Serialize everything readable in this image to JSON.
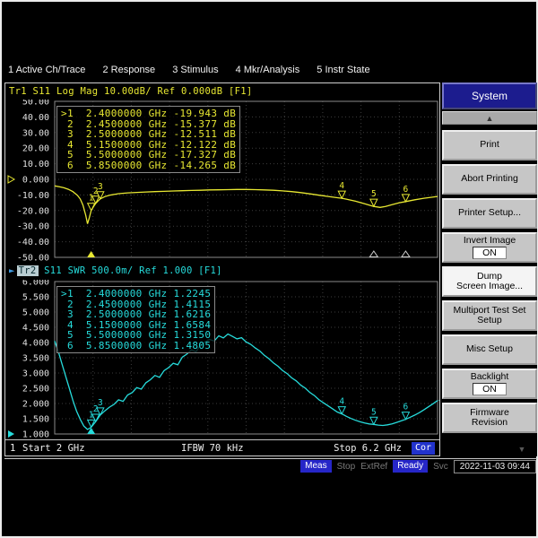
{
  "menu_bar": {
    "items": [
      "1 Active Ch/Trace",
      "2 Response",
      "3 Stimulus",
      "4 Mkr/Analysis",
      "5 Instr State"
    ]
  },
  "trace1": {
    "label": "Tr1",
    "params": "S11 Log Mag 10.00dB/ Ref 0.000dB [F1]",
    "markers": [
      {
        "sel": ">",
        "n": "1",
        "freq": "2.4000000 GHz",
        "val": "-19.943 dB"
      },
      {
        "sel": " ",
        "n": "2",
        "freq": "2.4500000 GHz",
        "val": "-15.377 dB"
      },
      {
        "sel": " ",
        "n": "3",
        "freq": "2.5000000 GHz",
        "val": "-12.511 dB"
      },
      {
        "sel": " ",
        "n": "4",
        "freq": "5.1500000 GHz",
        "val": "-12.122 dB"
      },
      {
        "sel": " ",
        "n": "5",
        "freq": "5.5000000 GHz",
        "val": "-17.327 dB"
      },
      {
        "sel": " ",
        "n": "6",
        "freq": "5.8500000 GHz",
        "val": "-14.265 dB"
      }
    ]
  },
  "trace2": {
    "pointer": "►",
    "label": "Tr2",
    "params": "S11 SWR 500.0m/ Ref 1.000 [F1]",
    "markers": [
      {
        "sel": ">",
        "n": "1",
        "freq": "2.4000000 GHz",
        "val": "1.2245"
      },
      {
        "sel": " ",
        "n": "2",
        "freq": "2.4500000 GHz",
        "val": "1.4115"
      },
      {
        "sel": " ",
        "n": "3",
        "freq": "2.5000000 GHz",
        "val": "1.6216"
      },
      {
        "sel": " ",
        "n": "4",
        "freq": "5.1500000 GHz",
        "val": "1.6584"
      },
      {
        "sel": " ",
        "n": "5",
        "freq": "5.5000000 GHz",
        "val": "1.3150"
      },
      {
        "sel": " ",
        "n": "6",
        "freq": "5.8500000 GHz",
        "val": "1.4805"
      }
    ]
  },
  "status_bar": {
    "channel": "1",
    "start": "Start 2 GHz",
    "ifbw": "IFBW 70 kHz",
    "stop": "Stop 6.2 GHz",
    "cor": "Cor"
  },
  "bottom_bar": {
    "meas": "Meas",
    "stop": "Stop",
    "extref": "ExtRef",
    "ready": "Ready",
    "svc": "Svc",
    "datetime": "2022-11-03 09:44"
  },
  "softkeys": {
    "title": "System",
    "up_icon": "▲",
    "down_icon": "▼",
    "buttons": [
      {
        "lines": [
          "Print"
        ]
      },
      {
        "lines": [
          "Abort Printing"
        ]
      },
      {
        "lines": [
          "Printer Setup..."
        ]
      },
      {
        "lines": [
          "Invert Image"
        ],
        "state": "ON"
      },
      {
        "lines": [
          "Dump",
          "Screen Image..."
        ],
        "selected": true
      },
      {
        "lines": [
          "Multiport Test Set",
          "Setup"
        ]
      },
      {
        "lines": [
          "Misc Setup"
        ]
      },
      {
        "lines": [
          "Backlight"
        ],
        "state": "ON"
      },
      {
        "lines": [
          "Firmware",
          "Revision"
        ]
      }
    ]
  },
  "colors": {
    "trace1": "#e8e832",
    "trace2": "#26dcdc",
    "grid": "#3d3d3d",
    "badge_blue": "#2626c8"
  },
  "chart_data": [
    {
      "type": "line",
      "title": "Tr1 S11 Log Mag 10.00dB/ Ref 0.000dB [F1]",
      "x_unit": "GHz",
      "y_unit": "dB",
      "x_range": [
        2.0,
        6.2
      ],
      "y_range": [
        -50,
        50
      ],
      "scale_per_div": "10.00dB/",
      "ref_level": "0.000dB",
      "color": "#e8e832",
      "y_tick_labels": [
        "50.00",
        "40.00",
        "30.00",
        "20.00",
        "10.00",
        "0.000",
        "-10.00",
        "-20.00",
        "-30.00",
        "-40.00",
        "-50.00"
      ],
      "ref_tick_index": 5,
      "ref_pointer": "hollow",
      "points": [
        [
          2.0,
          -4.2
        ],
        [
          2.05,
          -4.7
        ],
        [
          2.1,
          -5.4
        ],
        [
          2.15,
          -6.4
        ],
        [
          2.2,
          -7.9
        ],
        [
          2.25,
          -10.3
        ],
        [
          2.28,
          -12.6
        ],
        [
          2.31,
          -16.5
        ],
        [
          2.34,
          -23.0
        ],
        [
          2.36,
          -28.5
        ],
        [
          2.38,
          -24.6
        ],
        [
          2.4,
          -19.94
        ],
        [
          2.43,
          -17.1
        ],
        [
          2.45,
          -15.38
        ],
        [
          2.48,
          -13.6
        ],
        [
          2.5,
          -12.51
        ],
        [
          2.55,
          -11.1
        ],
        [
          2.6,
          -10.2
        ],
        [
          2.7,
          -9.2
        ],
        [
          2.8,
          -8.7
        ],
        [
          2.9,
          -8.4
        ],
        [
          3.0,
          -8.1
        ],
        [
          3.1,
          -7.9
        ],
        [
          3.2,
          -7.7
        ],
        [
          3.3,
          -7.5
        ],
        [
          3.4,
          -7.3
        ],
        [
          3.5,
          -7.1
        ],
        [
          3.6,
          -7.0
        ],
        [
          3.7,
          -6.8
        ],
        [
          3.8,
          -6.7
        ],
        [
          3.9,
          -6.6
        ],
        [
          4.0,
          -6.5
        ],
        [
          4.1,
          -6.5
        ],
        [
          4.2,
          -6.6
        ],
        [
          4.3,
          -6.8
        ],
        [
          4.4,
          -7.0
        ],
        [
          4.5,
          -7.4
        ],
        [
          4.6,
          -7.9
        ],
        [
          4.7,
          -8.5
        ],
        [
          4.8,
          -9.3
        ],
        [
          4.9,
          -10.2
        ],
        [
          5.0,
          -11.0
        ],
        [
          5.1,
          -11.8
        ],
        [
          5.15,
          -12.12
        ],
        [
          5.2,
          -12.7
        ],
        [
          5.3,
          -14.0
        ],
        [
          5.4,
          -15.7
        ],
        [
          5.5,
          -17.33
        ],
        [
          5.57,
          -18.0
        ],
        [
          5.63,
          -17.4
        ],
        [
          5.7,
          -16.2
        ],
        [
          5.78,
          -15.0
        ],
        [
          5.85,
          -14.27
        ],
        [
          5.95,
          -13.1
        ],
        [
          6.05,
          -12.1
        ],
        [
          6.2,
          -11.0
        ]
      ],
      "markers": [
        {
          "n": "1",
          "x": 2.4,
          "y": -19.943
        },
        {
          "n": "2",
          "x": 2.45,
          "y": -15.377
        },
        {
          "n": "3",
          "x": 2.5,
          "y": -12.511
        },
        {
          "n": "4",
          "x": 5.15,
          "y": -12.122
        },
        {
          "n": "5",
          "x": 5.5,
          "y": -17.327
        },
        {
          "n": "6",
          "x": 5.85,
          "y": -14.265
        }
      ],
      "axis_indicators": {
        "solid": [
          2.4
        ],
        "hollow": [
          5.5,
          5.85
        ]
      },
      "right_edge_pointer": null
    },
    {
      "type": "line",
      "title": "Tr2 S11 SWR 500.0m/ Ref 1.000 [F1]",
      "x_unit": "GHz",
      "y_unit": "SWR",
      "x_range": [
        2.0,
        6.2
      ],
      "y_range": [
        1,
        6
      ],
      "scale_per_div": "500.0m/",
      "ref_level": "1.000",
      "color": "#26dcdc",
      "y_tick_labels": [
        "6.000",
        "5.500",
        "5.000",
        "4.500",
        "4.000",
        "3.500",
        "3.000",
        "2.500",
        "2.000",
        "1.500",
        "1.000"
      ],
      "ref_tick_index": 10,
      "ref_pointer": "solid",
      "points": [
        [
          2.0,
          4.05
        ],
        [
          2.04,
          3.7
        ],
        [
          2.08,
          3.3
        ],
        [
          2.12,
          2.9
        ],
        [
          2.16,
          2.5
        ],
        [
          2.2,
          2.1
        ],
        [
          2.24,
          1.75
        ],
        [
          2.28,
          1.48
        ],
        [
          2.32,
          1.26
        ],
        [
          2.36,
          1.15
        ],
        [
          2.4,
          1.22
        ],
        [
          2.45,
          1.41
        ],
        [
          2.5,
          1.62
        ],
        [
          2.55,
          1.76
        ],
        [
          2.6,
          1.88
        ],
        [
          2.65,
          1.97
        ],
        [
          2.7,
          2.12
        ],
        [
          2.75,
          2.07
        ],
        [
          2.8,
          2.28
        ],
        [
          2.85,
          2.36
        ],
        [
          2.9,
          2.52
        ],
        [
          2.95,
          2.47
        ],
        [
          3.0,
          2.68
        ],
        [
          3.05,
          2.78
        ],
        [
          3.1,
          2.92
        ],
        [
          3.15,
          2.86
        ],
        [
          3.2,
          3.08
        ],
        [
          3.25,
          3.18
        ],
        [
          3.3,
          3.32
        ],
        [
          3.35,
          3.27
        ],
        [
          3.4,
          3.52
        ],
        [
          3.45,
          3.62
        ],
        [
          3.5,
          3.76
        ],
        [
          3.55,
          3.7
        ],
        [
          3.6,
          3.92
        ],
        [
          3.65,
          4.02
        ],
        [
          3.7,
          4.1
        ],
        [
          3.75,
          4.05
        ],
        [
          3.8,
          4.22
        ],
        [
          3.85,
          4.15
        ],
        [
          3.9,
          4.28
        ],
        [
          3.95,
          4.2
        ],
        [
          4.0,
          4.12
        ],
        [
          4.05,
          4.16
        ],
        [
          4.1,
          4.02
        ],
        [
          4.15,
          3.94
        ],
        [
          4.2,
          3.82
        ],
        [
          4.25,
          3.72
        ],
        [
          4.3,
          3.58
        ],
        [
          4.35,
          3.47
        ],
        [
          4.4,
          3.33
        ],
        [
          4.45,
          3.22
        ],
        [
          4.5,
          3.08
        ],
        [
          4.55,
          2.98
        ],
        [
          4.6,
          2.84
        ],
        [
          4.65,
          2.74
        ],
        [
          4.7,
          2.6
        ],
        [
          4.75,
          2.5
        ],
        [
          4.8,
          2.36
        ],
        [
          4.85,
          2.26
        ],
        [
          4.9,
          2.12
        ],
        [
          4.95,
          2.02
        ],
        [
          5.0,
          1.92
        ],
        [
          5.05,
          1.82
        ],
        [
          5.1,
          1.72
        ],
        [
          5.15,
          1.66
        ],
        [
          5.2,
          1.58
        ],
        [
          5.25,
          1.51
        ],
        [
          5.3,
          1.45
        ],
        [
          5.35,
          1.4
        ],
        [
          5.4,
          1.36
        ],
        [
          5.45,
          1.33
        ],
        [
          5.5,
          1.315
        ],
        [
          5.55,
          1.29
        ],
        [
          5.6,
          1.28
        ],
        [
          5.65,
          1.3
        ],
        [
          5.7,
          1.33
        ],
        [
          5.75,
          1.38
        ],
        [
          5.8,
          1.43
        ],
        [
          5.85,
          1.48
        ],
        [
          5.9,
          1.55
        ],
        [
          5.95,
          1.62
        ],
        [
          6.0,
          1.7
        ],
        [
          6.05,
          1.79
        ],
        [
          6.1,
          1.89
        ],
        [
          6.15,
          1.99
        ],
        [
          6.2,
          2.1
        ]
      ],
      "markers": [
        {
          "n": "1",
          "x": 2.4,
          "y": 1.2245
        },
        {
          "n": "2",
          "x": 2.45,
          "y": 1.4115
        },
        {
          "n": "3",
          "x": 2.5,
          "y": 1.6216
        },
        {
          "n": "4",
          "x": 5.15,
          "y": 1.6584
        },
        {
          "n": "5",
          "x": 5.5,
          "y": 1.315
        },
        {
          "n": "6",
          "x": 5.85,
          "y": 1.4805
        }
      ],
      "axis_indicators": {
        "solid": [
          2.4
        ],
        "hollow": []
      },
      "right_edge_pointer": 2.1
    }
  ]
}
